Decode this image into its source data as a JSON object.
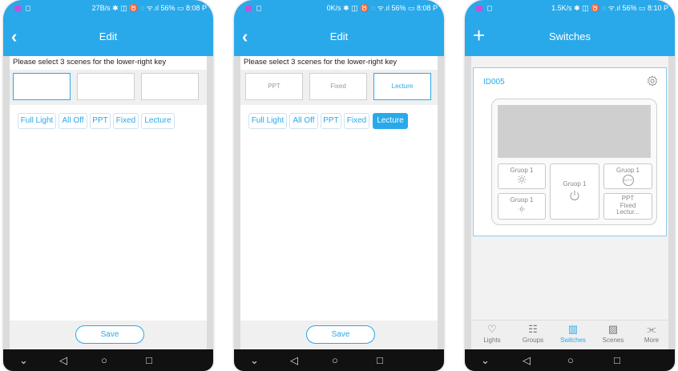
{
  "colors": {
    "accent": "#29a9ea",
    "navbar": "#111111",
    "panel_gray": "#cfcfcf"
  },
  "phones": [
    {
      "status": "27B/s ✱ ◫ ♉ ◌ ᯤ.ıl 56% ▭ 8:08 P",
      "title": "Edit",
      "prompt": "Please select 3 scenes for the lower-right key",
      "slots": [
        "",
        "",
        ""
      ],
      "chips": [
        "Full Light",
        "All Off",
        "PPT",
        "Fixed",
        "Lecture"
      ],
      "save": "Save"
    },
    {
      "status": "0K/s ✱ ◫ ♉ ◌ ᯤ.ıl 56% ▭ 8:08 P",
      "title": "Edit",
      "prompt": "Please select 3 scenes for the lower-right key",
      "slots": [
        "PPT",
        "Fixed",
        "Lecture"
      ],
      "chips": [
        "Full Light",
        "All Off",
        "PPT",
        "Fixed",
        "Lecture"
      ],
      "active_chip": "Lecture",
      "save": "Save"
    },
    {
      "status": "1.5K/s ✱ ◫ ♉ ◌ ᯤ.ıl 56% ▭ 8:10 P",
      "title": "Switches",
      "device_id": "ID005",
      "keys": {
        "top_left": "Gruop 1",
        "middle": "Gruop 1",
        "top_right": "Gruop 1",
        "bottom_left": "Gruop 1",
        "bottom_right_lines": [
          "PPT",
          "Fixed",
          "Lectur..."
        ]
      },
      "auto_badge": "AUTO",
      "tabs": [
        {
          "label": "Lights",
          "icon": "bulb-icon"
        },
        {
          "label": "Groups",
          "icon": "groups-icon"
        },
        {
          "label": "Switches",
          "icon": "switch-icon"
        },
        {
          "label": "Scenes",
          "icon": "scenes-icon"
        },
        {
          "label": "More",
          "icon": "share-icon"
        }
      ],
      "active_tab": "Switches"
    }
  ],
  "android_nav": {
    "down": "⌄",
    "back": "◁",
    "home": "○",
    "recent": "□"
  }
}
